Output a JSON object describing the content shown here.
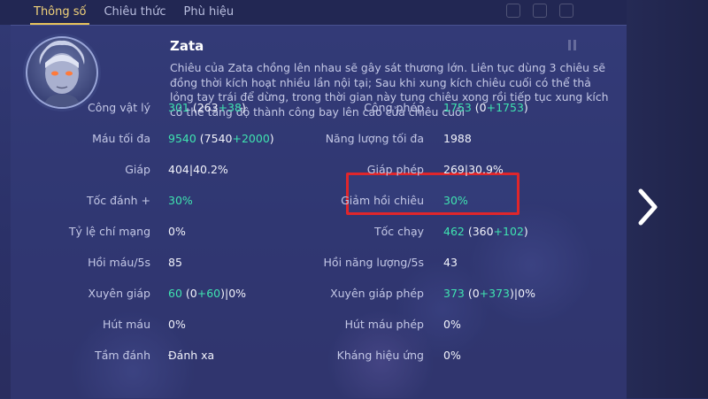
{
  "tabs": [
    {
      "label": "Thông số",
      "active": true
    },
    {
      "label": "Chiêu thức",
      "active": false
    },
    {
      "label": "Phù hiệu",
      "active": false
    }
  ],
  "hero": {
    "name": "Zata",
    "description": "Chiêu của Zata chồng lên nhau sẽ gây sát thương lớn. Liên tục dùng 3 chiêu sẽ đồng thời kích hoạt nhiều lần nội tại; Sau khi xung kích chiêu cuối có thể thả lỏng tay trái để dừng, trong thời gian này tung chiêu xong rồi tiếp tục xung kích có thể tăng độ thành công bay lên cao của chiêu cuối"
  },
  "stats_left": [
    {
      "label": "Công vật lý",
      "value": "301",
      "detail": " (263",
      "bonus": "+38",
      "suffix": ")",
      "pct": ""
    },
    {
      "label": "Máu tối đa",
      "value": "9540",
      "detail": " (7540",
      "bonus": "+2000",
      "suffix": ")",
      "pct": ""
    },
    {
      "label": "Giáp",
      "value": "404",
      "detail": "",
      "bonus": "",
      "suffix": "",
      "pct": "|40.2%"
    },
    {
      "label": "Tốc đánh +",
      "value": "30%",
      "detail": "",
      "bonus": "",
      "suffix": "",
      "pct": ""
    },
    {
      "label": "Tỷ lệ chí mạng",
      "value": "0%",
      "detail": "",
      "bonus": "",
      "suffix": "",
      "pct": ""
    },
    {
      "label": "Hồi máu/5s",
      "value": "85",
      "detail": "",
      "bonus": "",
      "suffix": "",
      "pct": ""
    },
    {
      "label": "Xuyên giáp",
      "value": "60",
      "detail": " (0",
      "bonus": "+60",
      "suffix": ")",
      "pct": "|0%"
    },
    {
      "label": "Hút máu",
      "value": "0%",
      "detail": "",
      "bonus": "",
      "suffix": "",
      "pct": ""
    },
    {
      "label": "Tầm đánh",
      "value": "Đánh xa",
      "detail": "",
      "bonus": "",
      "suffix": "",
      "pct": ""
    }
  ],
  "stats_right": [
    {
      "label": "Công phép",
      "value": "1753",
      "detail": " (0",
      "bonus": "+1753",
      "suffix": ")",
      "pct": ""
    },
    {
      "label": "Năng lượng tối đa",
      "value": "1988",
      "detail": "",
      "bonus": "",
      "suffix": "",
      "pct": ""
    },
    {
      "label": "Giáp phép",
      "value": "269",
      "detail": "",
      "bonus": "",
      "suffix": "",
      "pct": "|30.9%"
    },
    {
      "label": "Giảm hồi chiêu",
      "value": "30%",
      "detail": "",
      "bonus": "",
      "suffix": "",
      "pct": ""
    },
    {
      "label": "Tốc chạy",
      "value": "462",
      "detail": " (360",
      "bonus": "+102",
      "suffix": ")",
      "pct": ""
    },
    {
      "label": "Hồi năng lượng/5s",
      "value": "43",
      "detail": "",
      "bonus": "",
      "suffix": "",
      "pct": ""
    },
    {
      "label": "Xuyên giáp phép",
      "value": "373",
      "detail": " (0",
      "bonus": "+373",
      "suffix": ")",
      "pct": "|0%"
    },
    {
      "label": "Hút máu phép",
      "value": "0%",
      "detail": "",
      "bonus": "",
      "suffix": "",
      "pct": ""
    },
    {
      "label": "Kháng hiệu ứng",
      "value": "0%",
      "detail": "",
      "bonus": "",
      "suffix": "",
      "pct": ""
    }
  ],
  "colors": {
    "accent": "#e8c35a",
    "bonus_green": "#3fe3b0",
    "highlight_red": "#e0262b"
  },
  "icons": {
    "next": "chevron-right-icon",
    "avatar": "hero-portrait"
  }
}
